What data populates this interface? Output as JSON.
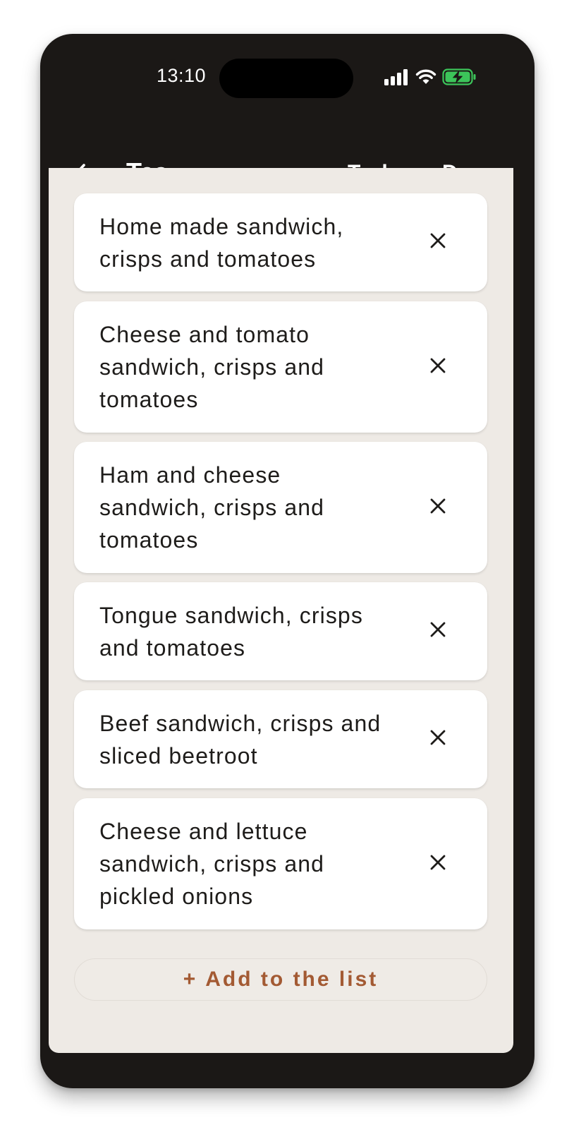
{
  "status_bar": {
    "time": "13:10",
    "icons": [
      "cellular-signal-icon",
      "wifi-icon",
      "battery-charging-icon"
    ]
  },
  "nav": {
    "back_icon": "chevron-left-icon",
    "title": "Tea",
    "today_label": "Today",
    "done_label": "Done"
  },
  "items": [
    {
      "label": "Home made sandwich, crisps and tomatoes",
      "remove_icon": "close-icon"
    },
    {
      "label": "Cheese and tomato sandwich, crisps and tomatoes",
      "remove_icon": "close-icon"
    },
    {
      "label": "Ham and cheese sandwich, crisps and tomatoes",
      "remove_icon": "close-icon"
    },
    {
      "label": "Tongue sandwich, crisps and tomatoes",
      "remove_icon": "close-icon"
    },
    {
      "label": "Beef sandwich, crisps and sliced beetroot",
      "remove_icon": "close-icon"
    },
    {
      "label": "Cheese and lettuce sandwich, crisps and pickled onions",
      "remove_icon": "close-icon"
    }
  ],
  "add_button": {
    "icon": "+",
    "label": "Add to the list"
  },
  "colors": {
    "frame": "#1b1816",
    "screen_background": "#eeeae5",
    "card": "#ffffff",
    "accent": "#a35a33",
    "battery": "#3cc45a"
  }
}
